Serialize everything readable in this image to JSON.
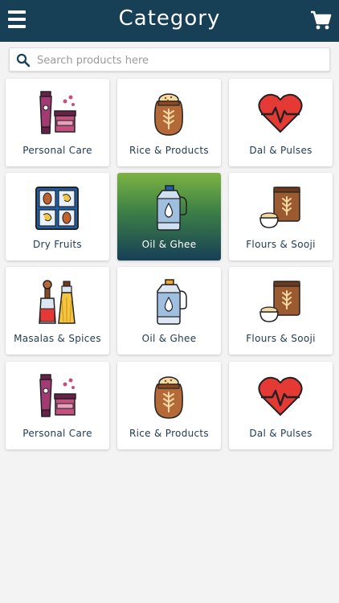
{
  "header": {
    "title": "Category",
    "menu_icon": "hamburger-menu-icon",
    "cart_icon": "shopping-cart-icon"
  },
  "search": {
    "placeholder": "Search products here",
    "value": "",
    "icon": "search-icon"
  },
  "categories": [
    {
      "label": "Personal Care",
      "icon": "personal-care-icon",
      "active": false
    },
    {
      "label": "Rice & Products",
      "icon": "rice-sack-icon",
      "active": false
    },
    {
      "label": "Dal & Pulses",
      "icon": "heart-pulse-icon",
      "active": false
    },
    {
      "label": "Dry Fruits",
      "icon": "dry-fruits-box-icon",
      "active": false
    },
    {
      "label": "Oil & Ghee",
      "icon": "oil-bottle-icon",
      "active": true
    },
    {
      "label": "Flours & Sooji",
      "icon": "flour-sack-icon",
      "active": false
    },
    {
      "label": "Masalas & Spices",
      "icon": "spice-bottles-icon",
      "active": false
    },
    {
      "label": "Oil & Ghee",
      "icon": "oil-bottle-icon",
      "active": false
    },
    {
      "label": "Flours & Sooji",
      "icon": "flour-sack-icon",
      "active": false
    },
    {
      "label": "Personal Care",
      "icon": "personal-care-icon",
      "active": false
    },
    {
      "label": "Rice & Products",
      "icon": "rice-sack-icon",
      "active": false
    },
    {
      "label": "Dal & Pulses",
      "icon": "heart-pulse-icon",
      "active": false
    }
  ],
  "colors": {
    "header_bg": "#173f56",
    "page_bg": "#f3f3f3",
    "active_gradient_top": "#7cb342",
    "active_gradient_bottom": "#173f56",
    "label_text": "#1f3a4f"
  }
}
